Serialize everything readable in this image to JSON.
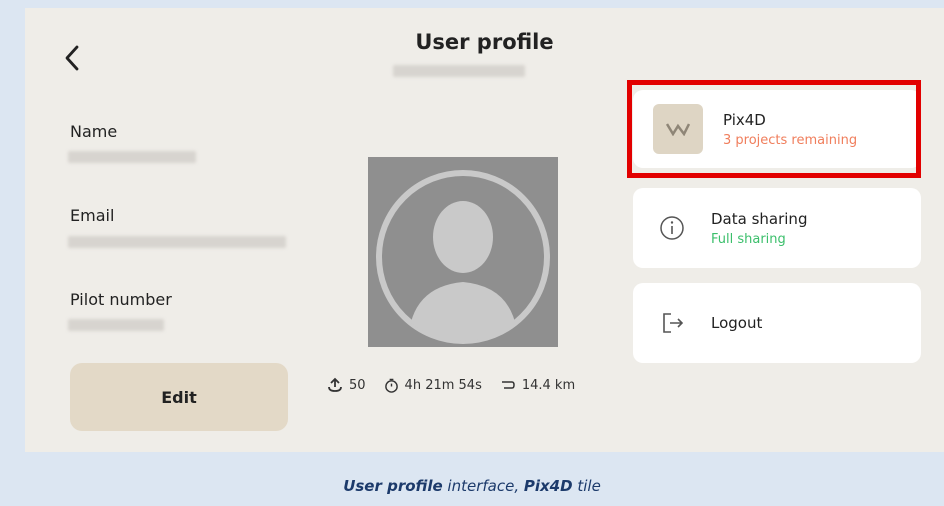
{
  "header": {
    "title": "User profile"
  },
  "fields": {
    "name_label": "Name",
    "email_label": "Email",
    "pilot_label": "Pilot number"
  },
  "actions": {
    "edit_label": "Edit"
  },
  "stats": {
    "uploads": "50",
    "flight_time": "4h 21m 54s",
    "distance": "14.4 km"
  },
  "cards": {
    "pix4d": {
      "title": "Pix4D",
      "subtitle": "3 projects remaining",
      "subtitle_color": "#f07e5c"
    },
    "data_sharing": {
      "title": "Data sharing",
      "subtitle": "Full sharing",
      "subtitle_color": "#3bbf6b"
    },
    "logout": {
      "title": "Logout"
    }
  },
  "caption": {
    "bold1": "User profile",
    "text1": " interface, ",
    "bold2": "Pix4D",
    "text2": " tile"
  },
  "icons": [
    "back-arrow-icon",
    "upload-icon",
    "timer-icon",
    "distance-icon",
    "pix4d-logo-icon",
    "info-icon",
    "logout-icon",
    "avatar-placeholder-icon"
  ]
}
